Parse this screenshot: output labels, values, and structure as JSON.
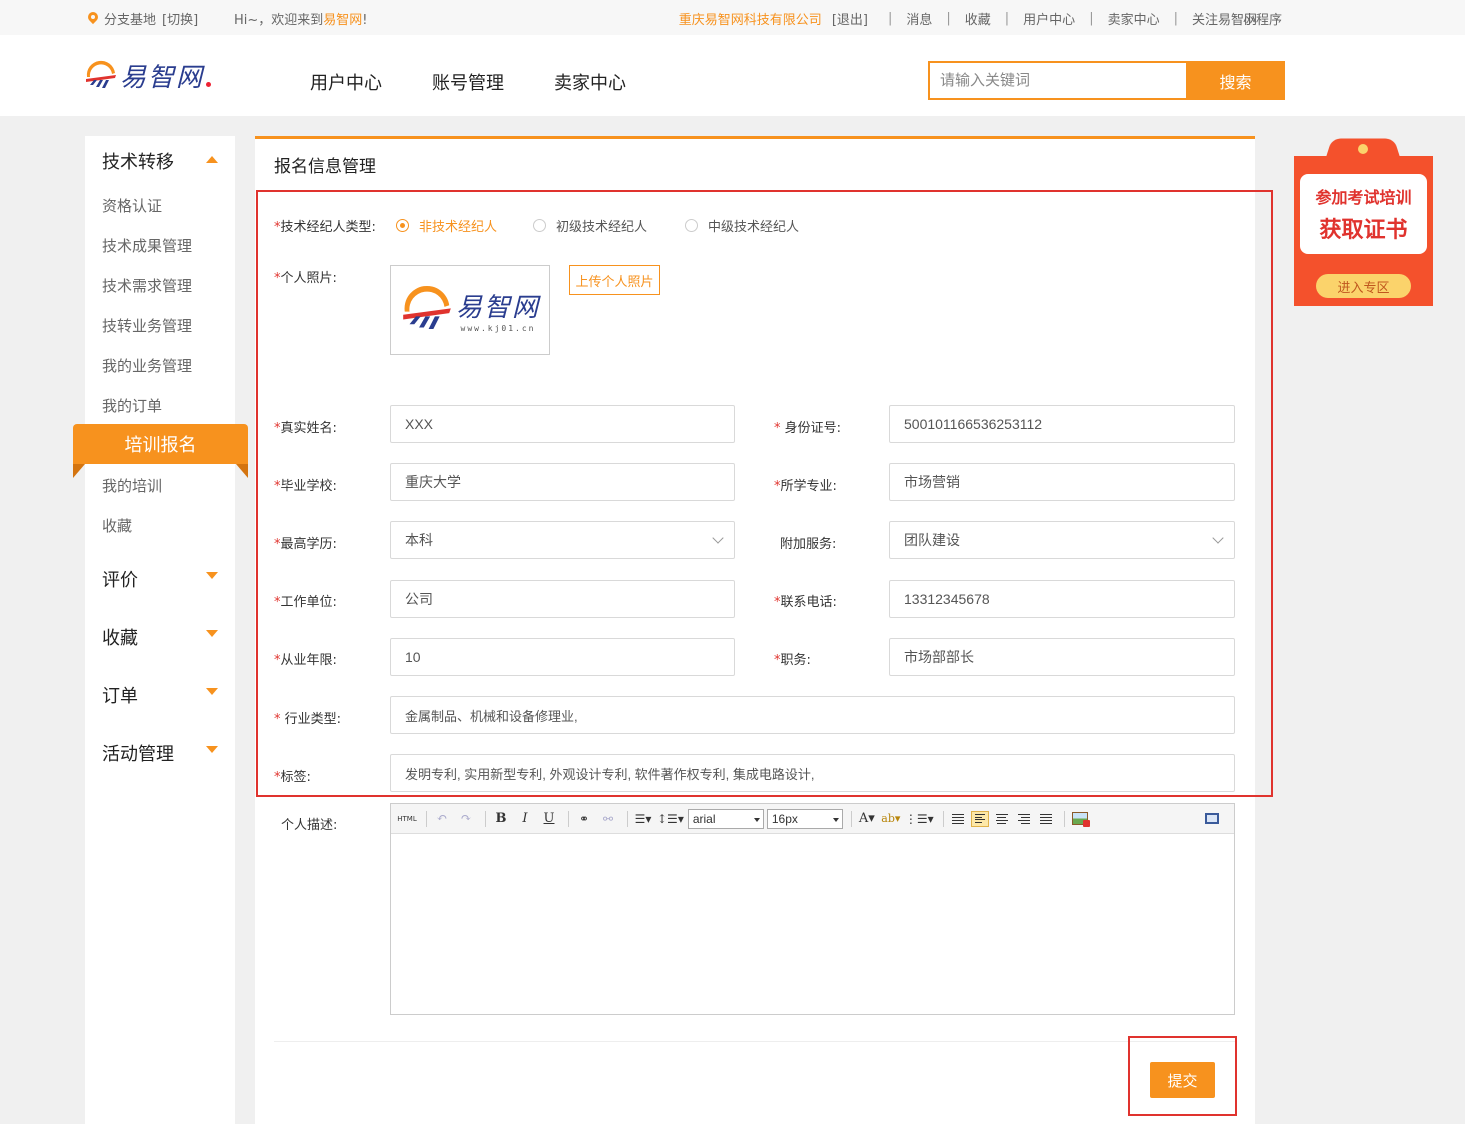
{
  "topbar": {
    "location": "分支基地",
    "switch": "[切换]",
    "welcome_prefix": "Hi~，欢迎来到",
    "welcome_brand": "易智网",
    "welcome_suffix": "!",
    "company": "重庆易智网科技有限公司",
    "logout": "[退出]",
    "links": [
      "消息",
      "收藏",
      "用户中心",
      "卖家中心",
      "关注易智网"
    ],
    "mini_program": "小程序"
  },
  "header": {
    "logo_text": "易智网",
    "nav": [
      "用户中心",
      "账号管理",
      "卖家中心"
    ],
    "search_placeholder": "请输入关键词",
    "search_button": "搜索"
  },
  "sidebar": {
    "group_tech": "技术转移",
    "items": [
      "资格认证",
      "技术成果管理",
      "技术需求管理",
      "技转业务管理",
      "我的业务管理",
      "我的订单"
    ],
    "active": "培训报名",
    "items_after": [
      "我的培训",
      "收藏"
    ],
    "groups": [
      "评价",
      "收藏",
      "订单",
      "活动管理"
    ]
  },
  "main": {
    "title": "报名信息管理",
    "broker_type_label": "技术经纪人类型:",
    "broker_types": [
      "非技术经纪人",
      "初级技术经纪人",
      "中级技术经纪人"
    ],
    "photo_label": "个人照片:",
    "photo_logo_text": "易智网",
    "photo_logo_url": "www.kj01.cn",
    "upload_button": "上传个人照片",
    "fields": {
      "name_label": "真实姓名:",
      "name_value": "XXX",
      "id_label": "身份证号:",
      "id_value": "500101166536253112",
      "school_label": "毕业学校:",
      "school_value": "重庆大学",
      "major_label": "所学专业:",
      "major_value": "市场营销",
      "edu_label": "最高学历:",
      "edu_value": "本科",
      "service_label": "附加服务:",
      "service_value": "团队建设",
      "work_label": "工作单位:",
      "work_value": "公司",
      "phone_label": "联系电话:",
      "phone_value": "13312345678",
      "years_label": "从业年限:",
      "years_value": "10",
      "position_label": "职务:",
      "position_value": "市场部部长",
      "industry_label": "行业类型:",
      "industry_value": "金属制品、机械和设备修理业,",
      "tags_label": "标签:",
      "tags_value": "发明专利, 实用新型专利, 外观设计专利, 软件著作权专利, 集成电路设计,",
      "desc_label": "个人描述:"
    },
    "editor": {
      "html_btn": "HTML",
      "font_family": "arial",
      "font_size": "16px"
    },
    "submit": "提交"
  },
  "promo": {
    "line1": "参加考试培训",
    "line2": "获取证书",
    "enter": "进入专区"
  },
  "colors": {
    "accent": "#f7921e",
    "highlight": "#e0332e"
  }
}
